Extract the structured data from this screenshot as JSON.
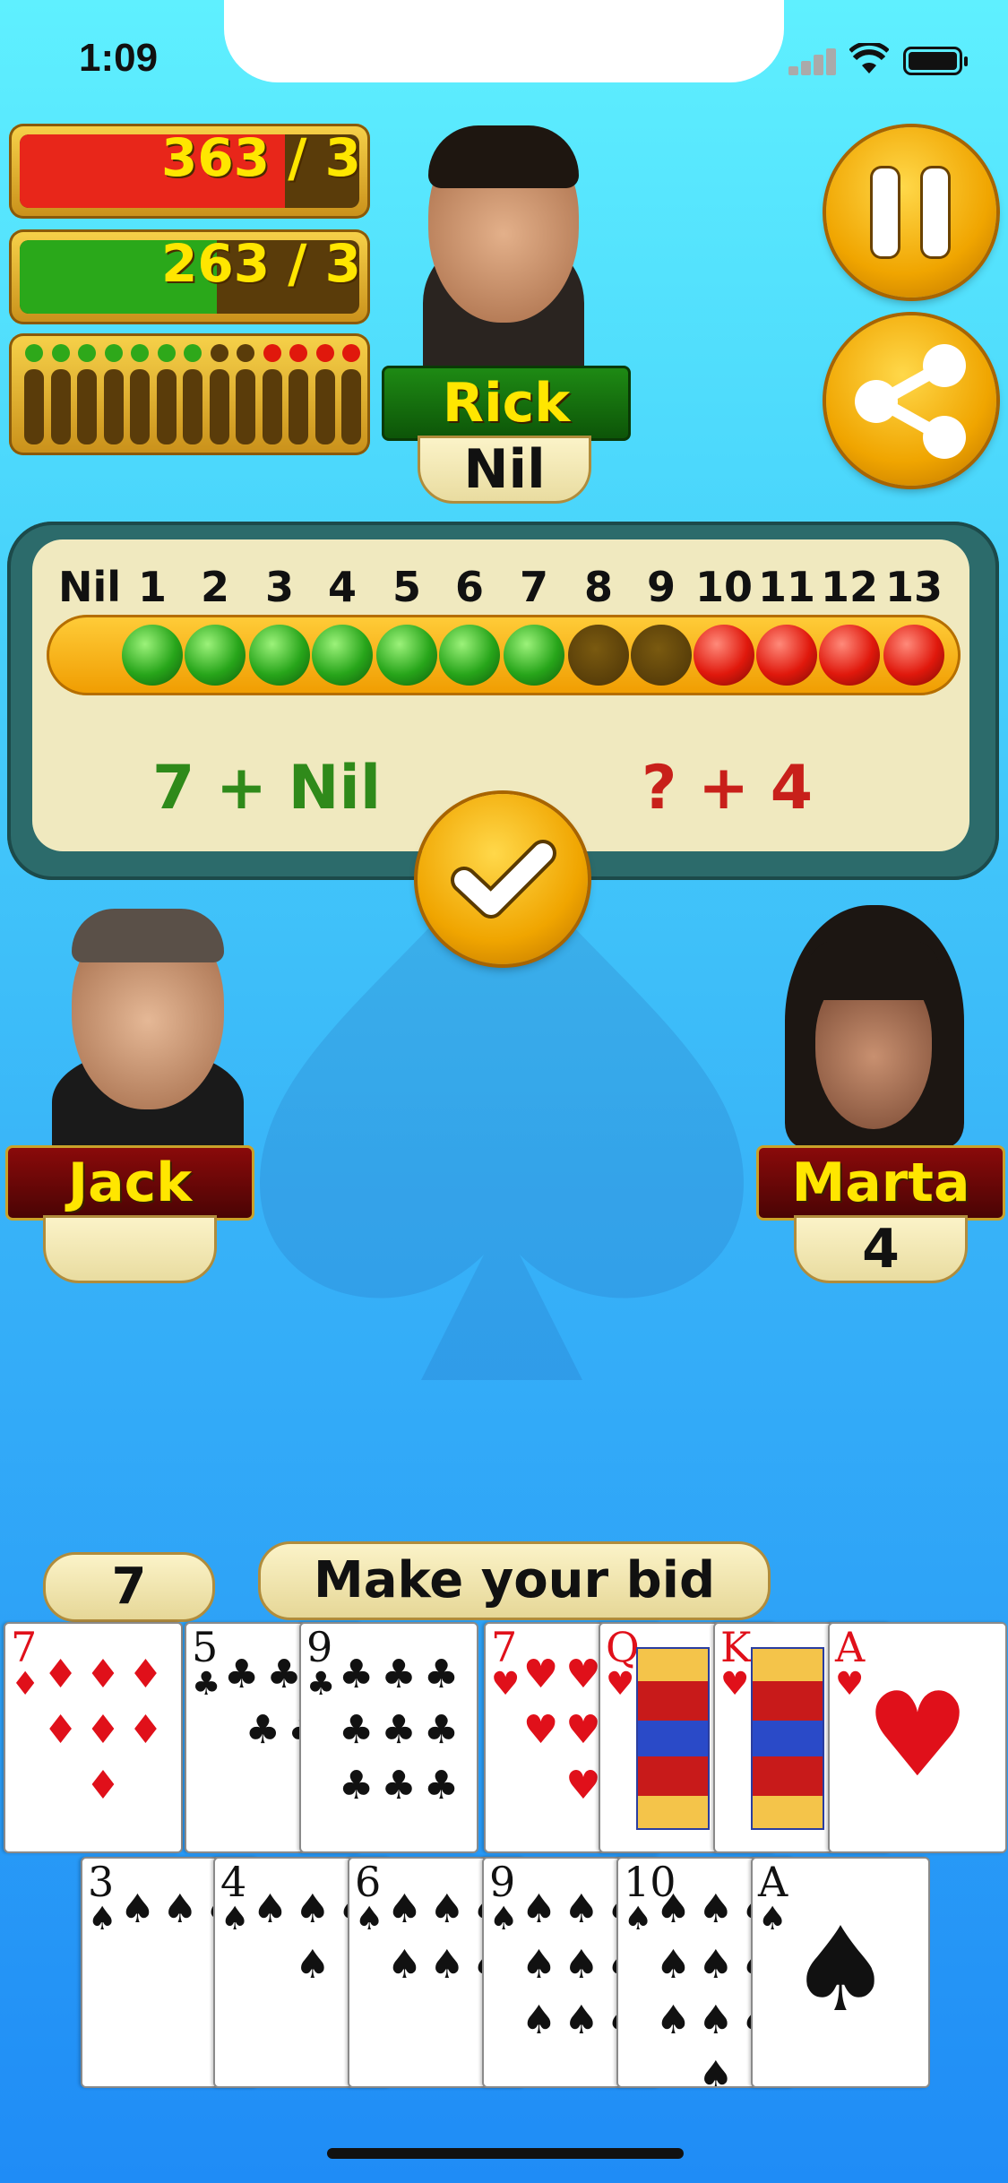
{
  "status_bar": {
    "time": "1:09"
  },
  "scores": [
    {
      "text": "363 / 3",
      "fill_color": "#e8261a",
      "fill_fraction": 0.78
    },
    {
      "text": "263 / 3",
      "fill_color": "#2aa81a",
      "fill_fraction": 0.58
    }
  ],
  "tricks_tracker": {
    "dots": [
      "green",
      "green",
      "green",
      "green",
      "green",
      "green",
      "green",
      "dark",
      "dark",
      "red",
      "red",
      "red",
      "red"
    ]
  },
  "players": {
    "top": {
      "name": "Rick",
      "bid": "Nil"
    },
    "left": {
      "name": "Jack",
      "bid": ""
    },
    "right": {
      "name": "Marta",
      "bid": "4"
    }
  },
  "buttons": {
    "pause": "pause-icon",
    "share": "share-icon",
    "confirm": "check-icon"
  },
  "bid_panel": {
    "numbers": [
      "Nil",
      "1",
      "2",
      "3",
      "4",
      "5",
      "6",
      "7",
      "8",
      "9",
      "10",
      "11",
      "12",
      "13"
    ],
    "balls": [
      "green",
      "green",
      "green",
      "green",
      "green",
      "green",
      "green",
      "dark",
      "dark",
      "red",
      "red",
      "red",
      "red"
    ],
    "my_team": "7 + Nil",
    "opponents": "? + 4"
  },
  "hint": {
    "current_bid": "7",
    "message": "Make your bid"
  },
  "hand": {
    "row1": [
      {
        "rank": "7",
        "suit": "♦",
        "color": "red"
      },
      {
        "rank": "5",
        "suit": "♣",
        "color": "black"
      },
      {
        "rank": "9",
        "suit": "♣",
        "color": "black"
      },
      {
        "rank": "7",
        "suit": "♥",
        "color": "red"
      },
      {
        "rank": "Q",
        "suit": "♥",
        "color": "red"
      },
      {
        "rank": "K",
        "suit": "♥",
        "color": "red"
      },
      {
        "rank": "A",
        "suit": "♥",
        "color": "red"
      }
    ],
    "row2": [
      {
        "rank": "3",
        "suit": "♠",
        "color": "black"
      },
      {
        "rank": "4",
        "suit": "♠",
        "color": "black"
      },
      {
        "rank": "6",
        "suit": "♠",
        "color": "black"
      },
      {
        "rank": "9",
        "suit": "♠",
        "color": "black"
      },
      {
        "rank": "10",
        "suit": "♠",
        "color": "black"
      },
      {
        "rank": "A",
        "suit": "♠",
        "color": "black"
      }
    ]
  },
  "background_icon": "spade-icon"
}
